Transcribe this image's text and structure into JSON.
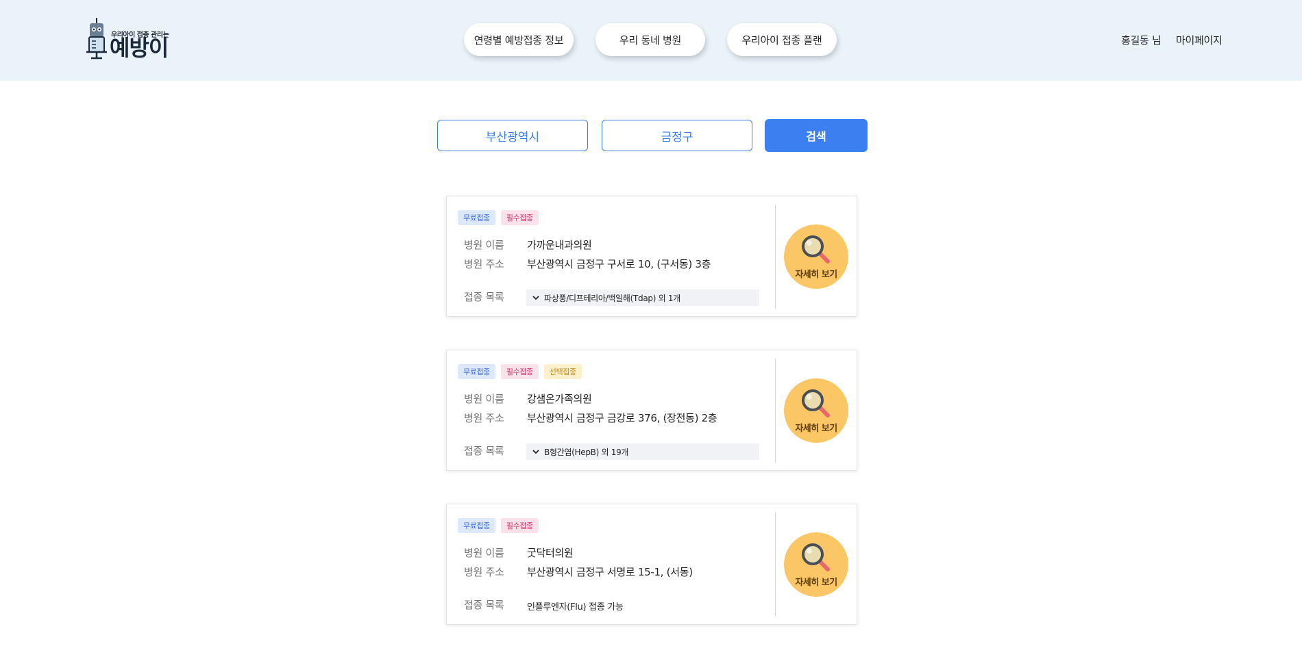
{
  "header": {
    "logo_tagline": "우리아이 접종 관리는",
    "logo_name": "예방이",
    "nav": [
      {
        "label": "연령별 예방접종 정보"
      },
      {
        "label": "우리 동네 병원"
      },
      {
        "label": "우리아이 접종 플랜"
      }
    ],
    "user_name": "홍길동 님",
    "mypage_label": "마이페이지"
  },
  "search": {
    "city": "부산광역시",
    "district": "금정구",
    "button_label": "검색"
  },
  "labels": {
    "name": "병원 이름",
    "address": "병원 주소",
    "vaccines": "접종 목록",
    "detail": "자세히 보기"
  },
  "hospitals": [
    {
      "tags": [
        "무료접종",
        "필수접종"
      ],
      "name": "가까운내과의원",
      "address": "부산광역시 금정구 구서로 10, (구서동) 3층",
      "vaccines": "파상풍/디프테리아/백일해(Tdap) 외 1개"
    },
    {
      "tags": [
        "무료접종",
        "필수접종",
        "선택접종"
      ],
      "name": "강샘온가족의원",
      "address": "부산광역시 금정구 금강로 376, (장전동) 2층",
      "vaccines": "B형간염(HepB) 외 19개"
    },
    {
      "tags": [
        "무료접종",
        "필수접종"
      ],
      "name": "굿닥터의원",
      "address": "부산광역시 금정구 서명로 15-1, (서동)",
      "vaccines": "인플루엔자(Flu) 접종 가능"
    }
  ],
  "colors": {
    "header_bg": "#eaf2fa",
    "accent_blue": "#3b7ff0",
    "detail_button": "#fbc766"
  },
  "icons": {
    "logo_mascot": "syringe-mascot-icon",
    "detail": "magnifier-icon",
    "expand": "chevron-down-icon"
  }
}
